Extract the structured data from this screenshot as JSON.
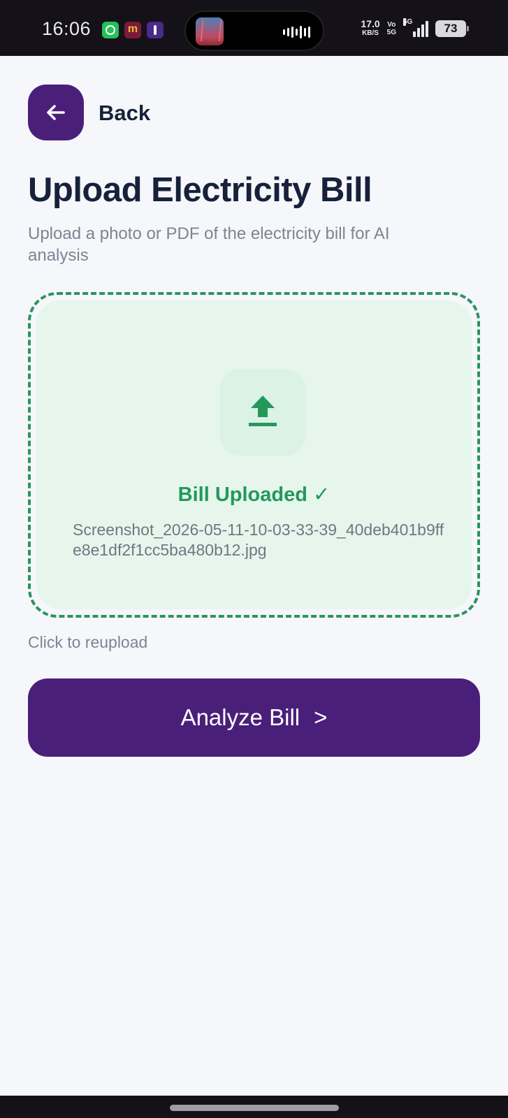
{
  "status_bar": {
    "time": "16:06",
    "net_speed_value": "17.0",
    "net_speed_unit": "KB/S",
    "volte_top": "Vo",
    "volte_bottom": "5G",
    "network_type": "5G",
    "battery": "73",
    "notification_icons": [
      "whatsapp-icon",
      "m-app-icon",
      "figure-app-icon"
    ]
  },
  "header": {
    "back_label": "Back"
  },
  "main": {
    "title": "Upload Electricity Bill",
    "subtitle": "Upload a photo or PDF of the electricity bill for AI analysis",
    "upload": {
      "status": "Bill Uploaded ✓",
      "filename": "Screenshot_2026-05-11-10-03-33-39_40deb401b9ffe8e1df2f1cc5ba480b12.jpg",
      "icon": "upload-icon"
    },
    "reupload_hint": "Click to reupload",
    "analyze_label": "Analyze Bill",
    "analyze_chevron": ">"
  },
  "colors": {
    "primary": "#4a1f7a",
    "success": "#22995a",
    "success_bg": "#e7f6ec",
    "title": "#17213a",
    "muted": "#7c8594"
  }
}
